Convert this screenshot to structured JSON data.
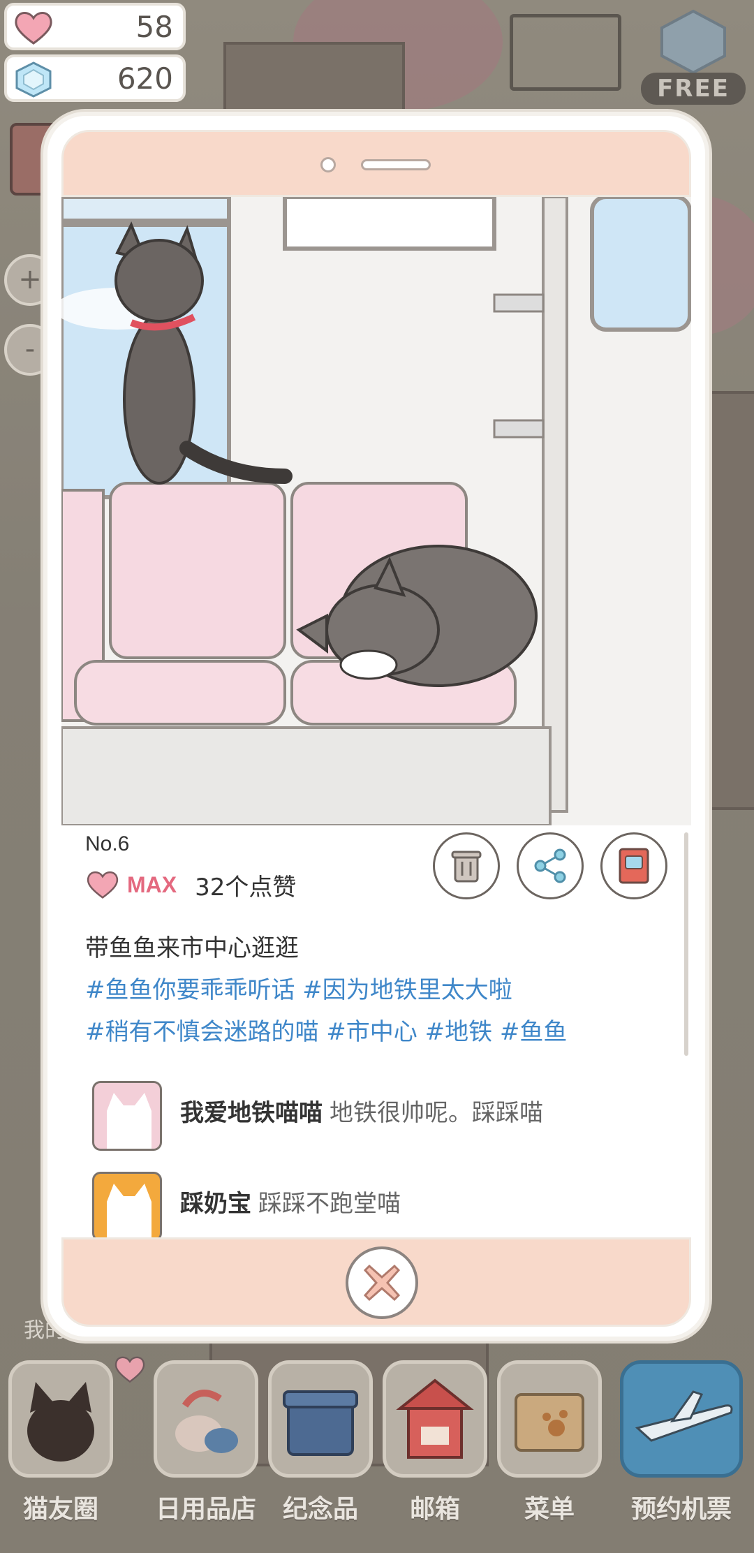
{
  "stats": {
    "hearts": "58",
    "gems": "620"
  },
  "free_button": {
    "label": "FREE"
  },
  "zoom": {
    "in": "+",
    "out": "-"
  },
  "my_room_label": "我的房",
  "post": {
    "number": "No.6",
    "like_level": "MAX",
    "like_count": "32个点赞",
    "caption": "带鱼鱼来市中心逛逛",
    "tags_line1": "#鱼鱼你要乖乖听话 #因为地铁里太大啦",
    "tags_line2": "#稍有不慎会迷路的喵 #市中心 #地铁 #鱼鱼",
    "actions": [
      "delete-icon",
      "share-icon",
      "album-icon"
    ],
    "comments": [
      {
        "user": "我爱地铁喵喵",
        "text": "地铁很帅呢。踩踩喵",
        "avatar_color": "#f3cfd8"
      },
      {
        "user": "踩奶宝",
        "text": "踩踩不跑堂喵",
        "avatar_color": "#f3a93d"
      }
    ]
  },
  "dock": [
    {
      "label": "猫友圈",
      "icon": "cat-friends-icon"
    },
    {
      "label": "日用品店",
      "icon": "shop-icon"
    },
    {
      "label": "纪念品",
      "icon": "souvenir-box-icon"
    },
    {
      "label": "邮箱",
      "icon": "mailbox-icon"
    },
    {
      "label": "菜单",
      "icon": "menu-folder-icon"
    },
    {
      "label": "预约机票",
      "icon": "airplane-icon"
    }
  ],
  "colors": {
    "accent_pink": "#f8d9ca",
    "hashtag_blue": "#3f87c9",
    "max_pink": "#e4697f"
  }
}
